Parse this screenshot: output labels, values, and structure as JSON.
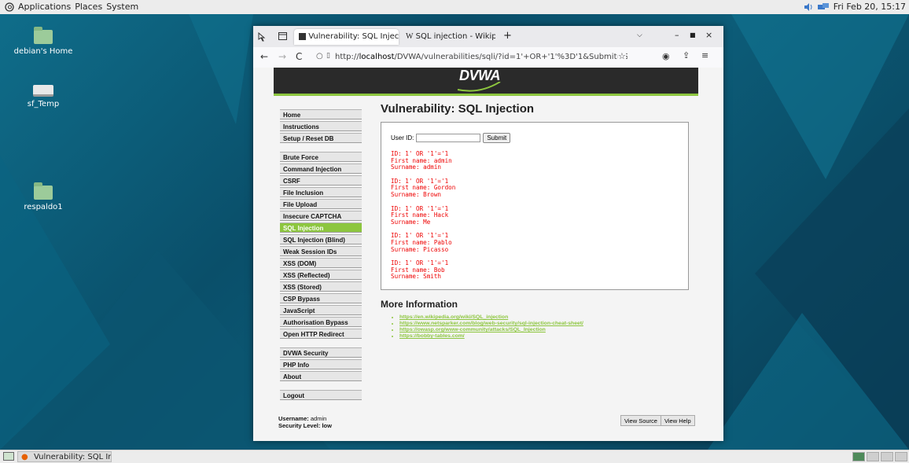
{
  "top_panel": {
    "menus": [
      "Applications",
      "Places",
      "System"
    ],
    "clock": "Fri Feb 20, 15:17"
  },
  "desktop": {
    "icons": [
      {
        "label": "debian's Home"
      },
      {
        "label": "sf_Temp"
      },
      {
        "label": "respaldo1"
      }
    ],
    "colors": {
      "accent": "#0c5c78"
    }
  },
  "browser": {
    "tabs": [
      {
        "label": "Vulnerability: SQL Injectio"
      },
      {
        "label": "SQL injection - Wikipedia"
      }
    ],
    "url": {
      "prefix": "http://",
      "host": "localhost",
      "path": "/DVWA/vulnerabilities/sqli/?id=1'+OR+'1'%3D'1&Submit=Subm"
    }
  },
  "dvwa": {
    "logo": "DVWA",
    "menu": {
      "group1": [
        "Home",
        "Instructions",
        "Setup / Reset DB"
      ],
      "group2": [
        "Brute Force",
        "Command Injection",
        "CSRF",
        "File Inclusion",
        "File Upload",
        "Insecure CAPTCHA",
        "SQL Injection",
        "SQL Injection (Blind)",
        "Weak Session IDs",
        "XSS (DOM)",
        "XSS (Reflected)",
        "XSS (Stored)",
        "CSP Bypass",
        "JavaScript",
        "Authorisation Bypass",
        "Open HTTP Redirect"
      ],
      "group3": [
        "DVWA Security",
        "PHP Info",
        "About"
      ],
      "group4": [
        "Logout"
      ],
      "active": "SQL Injection"
    },
    "title": "Vulnerability: SQL Injection",
    "form": {
      "label": "User ID:",
      "value": "",
      "submit": "Submit"
    },
    "results": [
      {
        "id": "ID: 1' OR '1'='1",
        "first": "First name: admin",
        "surname": "Surname: admin"
      },
      {
        "id": "ID: 1' OR '1'='1",
        "first": "First name: Gordon",
        "surname": "Surname: Brown"
      },
      {
        "id": "ID: 1' OR '1'='1",
        "first": "First name: Hack",
        "surname": "Surname: Me"
      },
      {
        "id": "ID: 1' OR '1'='1",
        "first": "First name: Pablo",
        "surname": "Surname: Picasso"
      },
      {
        "id": "ID: 1' OR '1'='1",
        "first": "First name: Bob",
        "surname": "Surname: Smith"
      }
    ],
    "more_info": {
      "heading": "More Information",
      "links": [
        "https://en.wikipedia.org/wiki/SQL_injection",
        "https://www.netsparker.com/blog/web-security/sql-injection-cheat-sheet/",
        "https://owasp.org/www-community/attacks/SQL_Injection",
        "https://bobby-tables.com/"
      ]
    },
    "footer": {
      "username_label": "Username:",
      "username": "admin",
      "security_line": "Security Level: low",
      "view_source": "View Source",
      "view_help": "View Help"
    },
    "colors": {
      "accent": "#8dc63f",
      "result_text": "#ee0000",
      "header_bg": "#2a2a2a"
    }
  },
  "taskbar": {
    "item": "Vulnerability: SQL Inje..."
  }
}
